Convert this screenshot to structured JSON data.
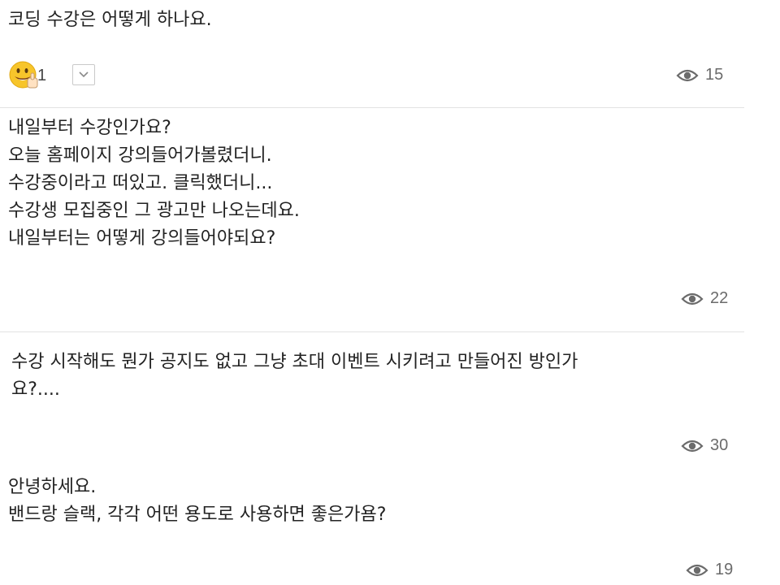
{
  "posts": [
    {
      "text": "코딩 수강은 어떻게 하나요.",
      "reaction_icon": "smile-thumbs-up-icon",
      "reaction_count": "1",
      "views": "15"
    },
    {
      "text": "내일부터 수강인가요?\n오늘 홈페이지 강의들어가볼렸더니.\n수강중이라고 떠있고. 클릭했더니...\n수강생 모집중인 그 광고만 나오는데요.\n내일부터는 어떻게 강의들어야되요?",
      "views": "22"
    },
    {
      "text": "수강 시작해도 뭔가 공지도 없고 그냥 초대 이벤트 시키려고 만들어진 방인가\n요?....",
      "views": "30"
    },
    {
      "text": "안녕하세요.\n밴드랑 슬랙, 각각 어떤 용도로 사용하면 좋은가욤?",
      "views": "19"
    }
  ],
  "icons": {
    "views": "eye-icon",
    "expand": "chevron-down-icon"
  }
}
